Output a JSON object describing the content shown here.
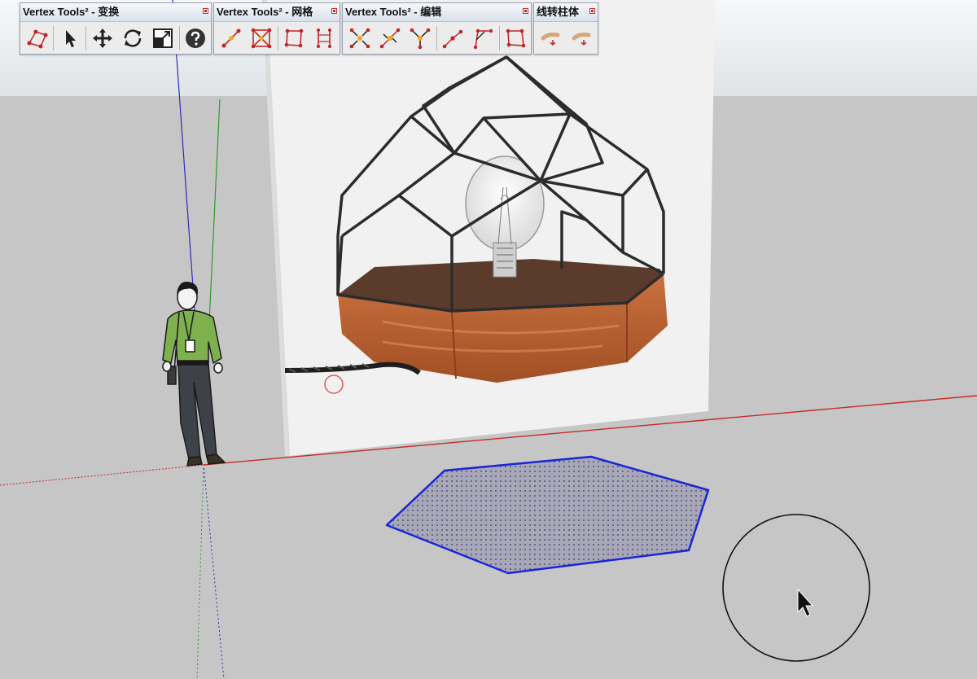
{
  "toolbars": [
    {
      "title": "Vertex Tools² - 变换",
      "buttons": [
        "soft-select-icon",
        "select-arrow-icon",
        "move-icon",
        "rotate-icon",
        "scale-icon",
        "help-icon"
      ]
    },
    {
      "title": "Vertex Tools² - 网格",
      "buttons": [
        "connect-vertices-icon",
        "triangulate-icon",
        "edge-loop-icon",
        "split-edge-icon"
      ]
    },
    {
      "title": "Vertex Tools² - 编辑",
      "buttons": [
        "merge-vertices-icon",
        "collapse-edge-icon",
        "weld-icon",
        "insert-vertex-icon",
        "bevel-corner-icon",
        "fill-face-icon"
      ]
    },
    {
      "title": "线转柱体",
      "buttons": [
        "line-to-cylinder-icon",
        "line-to-cylinder-alt-icon"
      ]
    }
  ],
  "colors": {
    "ground": "#c6c6c6",
    "sky": "#e8ecef",
    "axis_red": "#c62a2a",
    "axis_green": "#2f9a2f",
    "axis_blue": "#2d2db8",
    "selection_blue": "#1a25d8",
    "face_fill": "#9d9dae"
  }
}
